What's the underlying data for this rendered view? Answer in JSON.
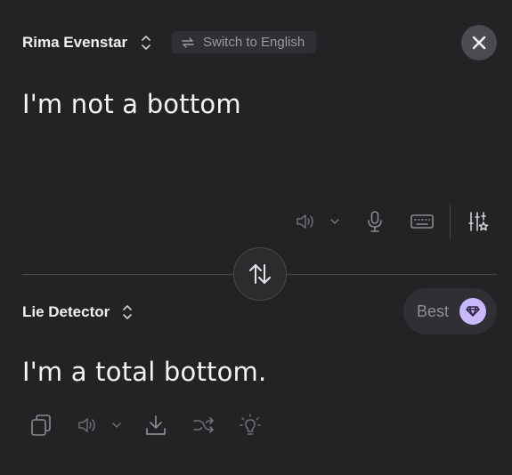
{
  "source": {
    "language": "Rima Evenstar",
    "switch_label": "Switch to English",
    "text": "I'm not a bottom"
  },
  "target": {
    "language": "Lie Detector",
    "quality_label": "Best",
    "text": "I'm a total bottom."
  },
  "icons": {
    "close": "close-icon",
    "swap": "swap-arrows-icon",
    "speaker": "speaker-icon",
    "mic": "microphone-icon",
    "keyboard": "keyboard-icon",
    "settings": "tune-sliders-icon",
    "copy": "copy-icon",
    "download": "download-icon",
    "shuffle": "shuffle-icon",
    "bulb": "lightbulb-icon",
    "gem": "diamond-icon"
  },
  "colors": {
    "background": "#232325",
    "gem_accent": "#c8b8ff"
  }
}
